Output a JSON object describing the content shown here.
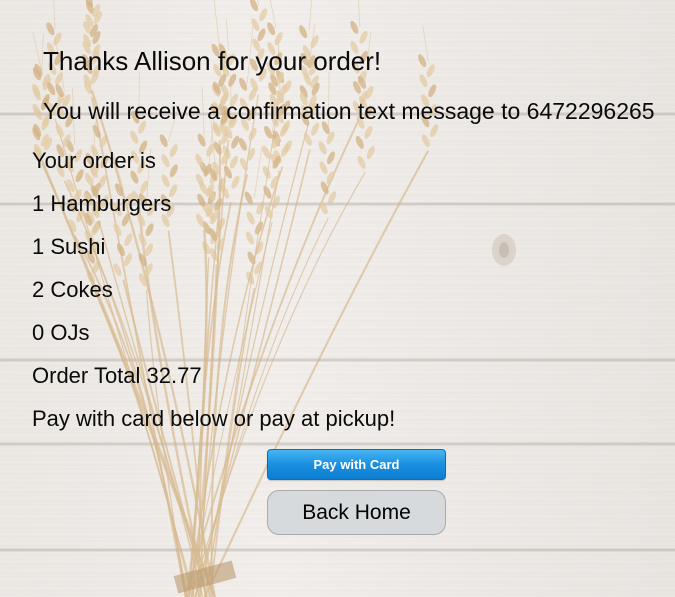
{
  "order": {
    "title": "Thanks Allison for your order!",
    "confirmation": "You will receive a confirmation text message to 6472296265",
    "intro": "Your order is",
    "items": [
      "1 Hamburgers",
      "1 Sushi",
      "2 Cokes",
      "0 OJs"
    ],
    "total": "Order Total 32.77",
    "payment_note": "Pay with card below or pay at pickup!"
  },
  "actions": {
    "pay_label": "Pay with Card",
    "home_label": "Back Home"
  },
  "colors": {
    "pay_button": "#1a8fe0",
    "home_button": "#d7dadc",
    "background": "#ece8e4"
  },
  "background_image": "wheat-bundle-on-white-wood"
}
